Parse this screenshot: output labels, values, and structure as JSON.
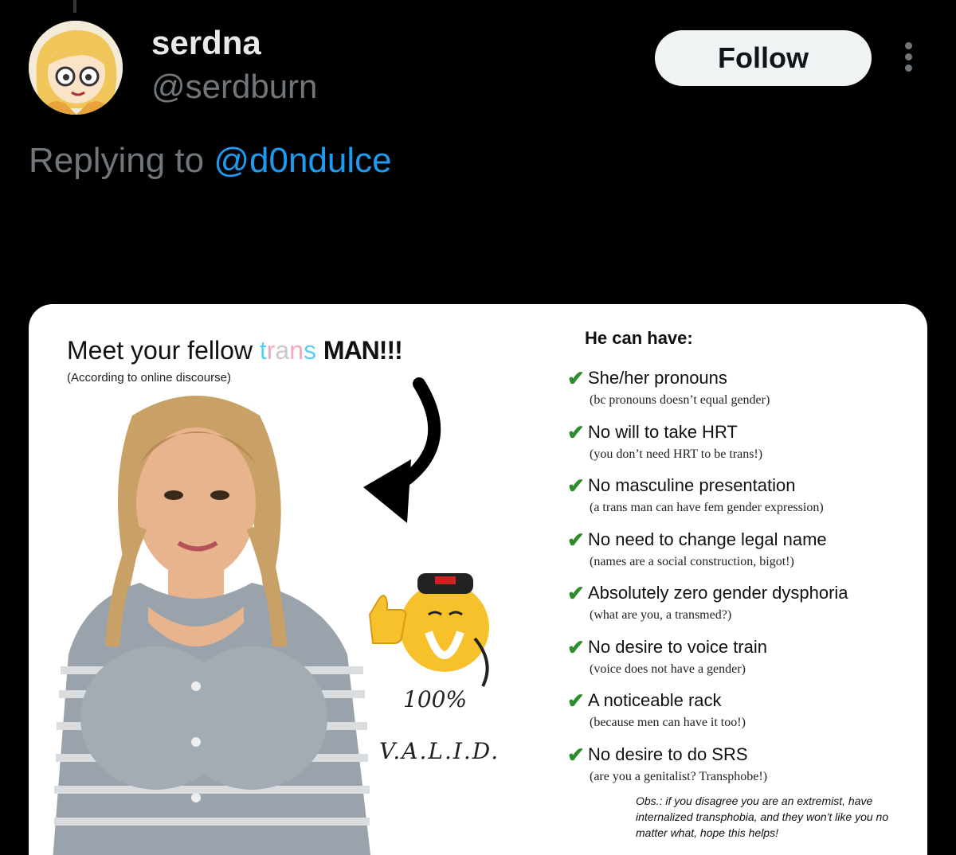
{
  "author": {
    "display_name": "serdna",
    "handle": "@serdburn",
    "avatar_icon": "cartoon-girl-avatar"
  },
  "actions": {
    "follow_label": "Follow",
    "more_icon": "more-vertical-icon"
  },
  "reply": {
    "prefix": "Replying to ",
    "mention": "@d0ndulce"
  },
  "meme": {
    "headline_pre": "Meet your fellow ",
    "headline_trans": [
      "t",
      "r",
      "a",
      "n",
      "s"
    ],
    "headline_man": "MAN!!!",
    "subhead": "(According to online discourse)",
    "percent": "100%",
    "valid": "V.A.L.I.D.",
    "list_title": "He can have:",
    "items": [
      {
        "label": "She/her pronouns",
        "sub": "(bc pronouns doesn’t equal gender)"
      },
      {
        "label": "No will to take HRT",
        "sub": "(you don’t need HRT to be trans!)"
      },
      {
        "label": "No masculine presentation",
        "sub": "(a trans man can have fem gender expression)"
      },
      {
        "label": "No need to change legal name",
        "sub": "(names are a social construction, bigot!)"
      },
      {
        "label": "Absolutely zero gender dysphoria",
        "sub": "(what are you, a transmed?)"
      },
      {
        "label": "No desire to voice train",
        "sub": "(voice does not have a gender)"
      },
      {
        "label": "A noticeable rack",
        "sub": "(because men can have it too!)"
      },
      {
        "label": "No desire to do SRS",
        "sub": "(are you a genitalist? Transphobe!)"
      }
    ],
    "obs": "Obs.: if you disagree you are an extremist, have internalized transphobia, and they won't like you no matter what, hope this helps!",
    "check_glyph": "✔"
  },
  "colors": {
    "accent": "#1d9bf0",
    "check": "#2e8b2e"
  }
}
